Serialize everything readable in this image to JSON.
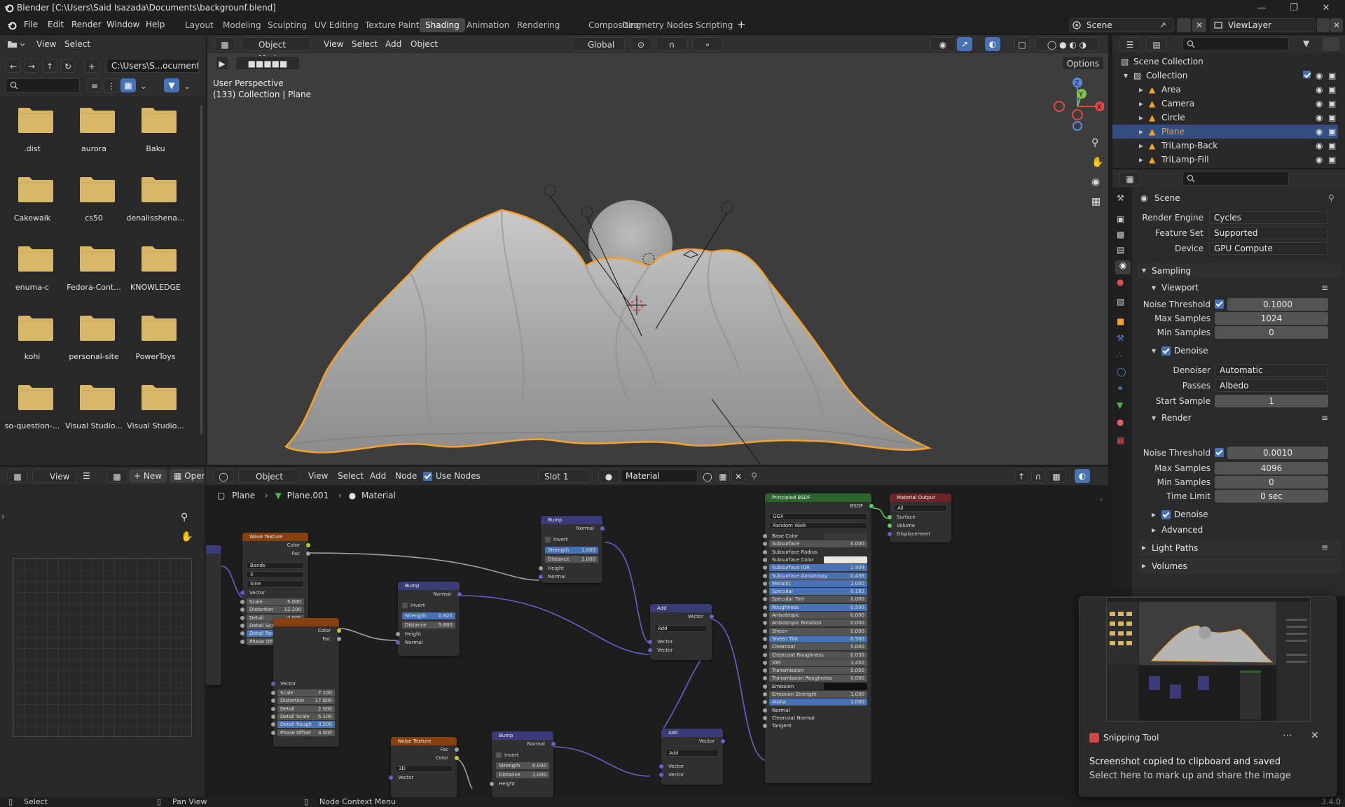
{
  "window": {
    "title": "Blender [C:\\Users\\Said Isazada\\Documents\\backgrounf.blend]",
    "controls": [
      "minimize",
      "maximize",
      "close"
    ]
  },
  "menus": [
    "File",
    "Edit",
    "Render",
    "Window",
    "Help"
  ],
  "workspaces": [
    "Layout",
    "Modeling",
    "Sculpting",
    "UV Editing",
    "Texture Paint",
    "Shading",
    "Animation",
    "Rendering",
    "Compositing",
    "Geometry Nodes",
    "Scripting"
  ],
  "active_workspace": "Shading",
  "scene": {
    "name": "Scene",
    "view_layer": "ViewLayer"
  },
  "file_browser": {
    "menus": [
      "View",
      "Select"
    ],
    "path": "C:\\Users\\S...ocuments\\",
    "folders": [
      ".dist",
      "aurora",
      "Baku",
      "Cakewalk",
      "cs50",
      "denalisshena...",
      "enuma-c",
      "Fedora-Cont...",
      "KNOWLEDGE",
      "kohi",
      "personal-site",
      "PowerToys",
      "so-question-...",
      "Visual Studio...",
      "Visual Studio..."
    ]
  },
  "viewport": {
    "mode": "Object Mode",
    "menus": [
      "View",
      "Select",
      "Add",
      "Object"
    ],
    "orientation": "Global",
    "options_label": "Options",
    "overlay_text1": "User Perspective",
    "overlay_text2": "(133) Collection | Plane",
    "gizmo_axes": [
      "X",
      "Y",
      "Z"
    ]
  },
  "outliner": {
    "root": "Scene Collection",
    "collection": "Collection",
    "items": [
      {
        "name": "Area",
        "selected": false
      },
      {
        "name": "Camera",
        "selected": false
      },
      {
        "name": "Circle",
        "selected": false
      },
      {
        "name": "Plane",
        "selected": true
      },
      {
        "name": "TriLamp-Back",
        "selected": false
      },
      {
        "name": "TriLamp-Fill",
        "selected": false
      }
    ]
  },
  "properties": {
    "context": "Scene",
    "render_engine_label": "Render Engine",
    "render_engine": "Cycles",
    "feature_set_label": "Feature Set",
    "feature_set": "Supported",
    "device_label": "Device",
    "device": "GPU Compute",
    "sampling": "Sampling",
    "viewport_section": "Viewport",
    "noise_threshold_label": "Noise Threshold",
    "viewport_noise_threshold": "0.1000",
    "max_samples_label": "Max Samples",
    "viewport_max_samples": "1024",
    "min_samples_label": "Min Samples",
    "viewport_min_samples": "0",
    "denoise_label": "Denoise",
    "denoiser_label": "Denoiser",
    "denoiser": "Automatic",
    "passes_label": "Passes",
    "passes": "Albedo",
    "start_sample_label": "Start Sample",
    "start_sample": "1",
    "render_section": "Render",
    "render_noise_threshold": "0.0010",
    "render_max_samples": "4096",
    "render_min_samples": "0",
    "time_limit_label": "Time Limit",
    "time_limit": "0 sec",
    "advanced": "Advanced",
    "light_paths": "Light Paths",
    "volumes": "Volumes"
  },
  "image_editor": {
    "view_label": "View",
    "new_label": "New",
    "open_label": "Open"
  },
  "node_editor": {
    "type": "Object",
    "menus": [
      "View",
      "Select",
      "Add",
      "Node"
    ],
    "use_nodes": "Use Nodes",
    "slot": "Slot 1",
    "material": "Material",
    "breadcrumb": [
      "Plane",
      "Plane.001",
      "Material"
    ]
  },
  "nodes": {
    "wave1": {
      "title": "Wave Texture",
      "out_color": "Color",
      "out_fac": "Fac",
      "bands": "Bands",
      "axis": "X",
      "profile": "Sine",
      "vector": "Vector",
      "rows": [
        [
          "Scale",
          "5.000"
        ],
        [
          "Distortion",
          "12.200"
        ],
        [
          "Detail",
          "2.000"
        ],
        [
          "Detail Scale",
          "1.000"
        ],
        [
          "Detail Rough",
          "0.500"
        ],
        [
          "Phase Offset",
          "0.000"
        ]
      ]
    },
    "wave2": {
      "out_color": "Color",
      "out_fac": "Fac",
      "vector": "Vector",
      "rows": [
        [
          "Scale",
          "7.100"
        ],
        [
          "Distortion",
          "17.800"
        ],
        [
          "Detail",
          "2.000"
        ],
        [
          "Detail Scale",
          "5.100"
        ],
        [
          "Detail Rough",
          "0.500"
        ],
        [
          "Phase Offset",
          "3.000"
        ]
      ]
    },
    "bump_top": {
      "title": "Bump",
      "normal": "Normal",
      "invert": "Invert",
      "strength": [
        "Strength",
        "1.000"
      ],
      "distance": [
        "Distance",
        "1.000"
      ],
      "height": "Height",
      "normal_in": "Normal"
    },
    "bump_mid": {
      "title": "Bump",
      "normal": "Normal",
      "invert": "Invert",
      "strength": [
        "Strength",
        "0.825"
      ],
      "distance": [
        "Distance",
        "5.600"
      ],
      "height": "Height",
      "normal_in": "Normal"
    },
    "bump_bot": {
      "title": "Bump",
      "normal": "Normal",
      "invert": "Invert",
      "strength": [
        "Strength",
        "0.000"
      ],
      "distance": [
        "Distance",
        "1.000"
      ],
      "height": "Height"
    },
    "noise": {
      "title": "Noise Texture",
      "fac": "Fac",
      "color": "Color",
      "dim": "3D",
      "vector": "Vector"
    },
    "add1": {
      "title": "Add",
      "vector": "Vector",
      "op": "Add",
      "in1": "Vector",
      "in2": "Vector"
    },
    "add2": {
      "title": "Add",
      "vector": "Vector",
      "op": "Add",
      "in1": "Vector",
      "in2": "Vector"
    },
    "bsdf": {
      "title": "Principled BSDF",
      "out": "BSDF",
      "dist": "GGX",
      "sss": "Random Walk",
      "rows": [
        [
          "Base Color",
          ""
        ],
        [
          "Subsurface",
          "0.000"
        ],
        [
          "Subsurface Radius",
          ""
        ],
        [
          "Subsurface Color",
          ""
        ],
        [
          "Subsurface IOR",
          "2.909"
        ],
        [
          "Subsurface Anisotropy",
          "0.436"
        ],
        [
          "Metallic",
          "1.000"
        ],
        [
          "Specular",
          "0.182"
        ],
        [
          "Specular Tint",
          "0.000"
        ],
        [
          "Roughness",
          "0.500"
        ],
        [
          "Anisotropic",
          "0.000"
        ],
        [
          "Anisotropic Rotation",
          "0.000"
        ],
        [
          "Sheen",
          "0.000"
        ],
        [
          "Sheen Tint",
          "0.500"
        ],
        [
          "Clearcoat",
          "0.000"
        ],
        [
          "Clearcoat Roughness",
          "0.030"
        ],
        [
          "IOR",
          "1.450"
        ],
        [
          "Transmission",
          "0.000"
        ],
        [
          "Transmission Roughness",
          "0.000"
        ],
        [
          "Emission",
          ""
        ],
        [
          "Emission Strength",
          "1.000"
        ],
        [
          "Alpha",
          "1.000"
        ],
        [
          "Normal",
          ""
        ],
        [
          "Clearcoat Normal",
          ""
        ],
        [
          "Tangent",
          ""
        ]
      ]
    },
    "output": {
      "title": "Material Output",
      "target": "All",
      "surface": "Surface",
      "volume": "Volume",
      "displacement": "Displacement"
    }
  },
  "toast": {
    "app": "Snipping Tool",
    "message": "Screenshot copied to clipboard and saved",
    "sub": "Select here to mark up and share the image"
  },
  "status": {
    "select": "Select",
    "pan": "Pan View",
    "context": "Node Context Menu",
    "version": "3.4.0"
  },
  "colors": {
    "accent": "#4772b3",
    "selection_orange": "#f5a12c",
    "folder": "#d8b868"
  }
}
